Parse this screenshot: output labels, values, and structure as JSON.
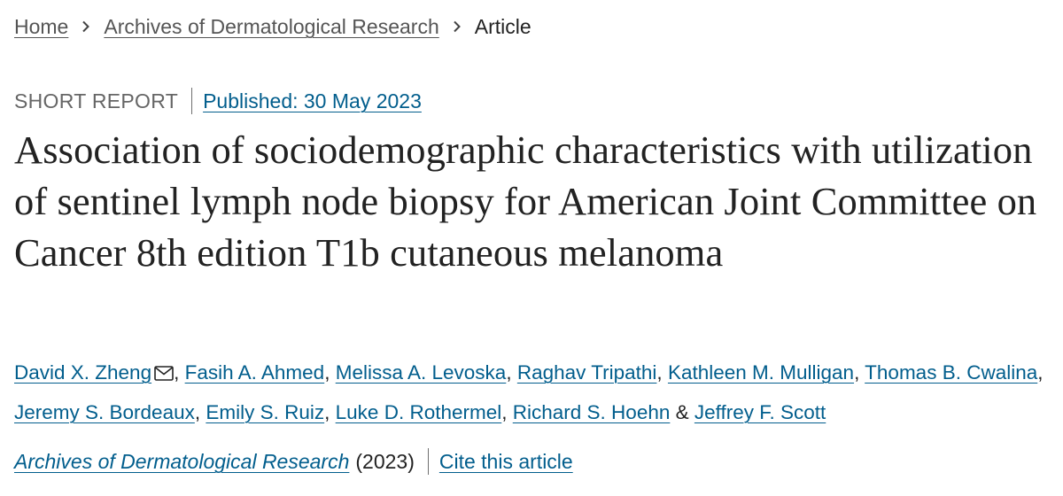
{
  "breadcrumb": {
    "items": [
      {
        "label": "Home"
      },
      {
        "label": "Archives of Dermatological Research"
      },
      {
        "label": "Article"
      }
    ],
    "separator_icon": "chevron-right-icon"
  },
  "meta": {
    "article_type": "SHORT REPORT",
    "published": "Published: 30 May 2023"
  },
  "article": {
    "title": "Association of sociodemographic characteristics with utilization of sentinel lymph node biopsy for American Joint Committee on Cancer 8th edition T1b cutaneous melanoma"
  },
  "authors": {
    "list": [
      {
        "name": "David X. Zheng",
        "corresponding": true
      },
      {
        "name": "Fasih A. Ahmed"
      },
      {
        "name": "Melissa A. Levoska"
      },
      {
        "name": "Raghav Tripathi"
      },
      {
        "name": "Kathleen M. Mulligan"
      },
      {
        "name": "Thomas B. Cwalina"
      },
      {
        "name": "Jeremy S. Bordeaux"
      },
      {
        "name": "Emily S. Ruiz"
      },
      {
        "name": "Luke D. Rothermel"
      },
      {
        "name": "Richard S. Hoehn"
      },
      {
        "name": "Jeffrey F. Scott"
      }
    ],
    "separator": ", ",
    "last_separator": " & ",
    "contact_icon": "envelope-icon"
  },
  "citation": {
    "journal": "Archives of Dermatological Research",
    "year": "(2023)",
    "cite_label": "Cite this article"
  },
  "colors": {
    "link": "#025e8d",
    "breadcrumb_link": "#555555",
    "text": "#222222",
    "muted": "#666666"
  }
}
